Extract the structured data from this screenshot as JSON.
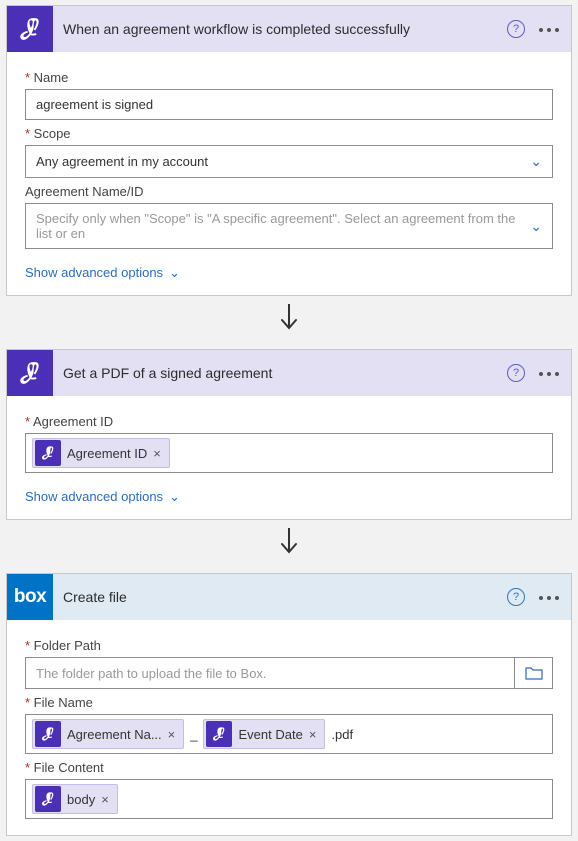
{
  "steps": [
    {
      "title": "When an agreement workflow is completed successfully",
      "fields": {
        "name_label": "Name",
        "name_value": "agreement is signed",
        "scope_label": "Scope",
        "scope_value": "Any agreement in my account",
        "agreement_label": "Agreement Name/ID",
        "agreement_placeholder": "Specify only when \"Scope\" is \"A specific agreement\". Select an agreement from the list or en"
      },
      "advanced": "Show advanced options"
    },
    {
      "title": "Get a PDF of a signed agreement",
      "fields": {
        "id_label": "Agreement ID",
        "id_token": "Agreement ID"
      },
      "advanced": "Show advanced options"
    },
    {
      "title": "Create file",
      "fields": {
        "folder_label": "Folder Path",
        "folder_placeholder": "The folder path to upload the file to Box.",
        "filename_label": "File Name",
        "filename_tokens": [
          "Agreement Na...",
          "Event Date"
        ],
        "filename_sep": "_",
        "filename_suffix": ".pdf",
        "content_label": "File Content",
        "content_token": "body"
      }
    }
  ]
}
